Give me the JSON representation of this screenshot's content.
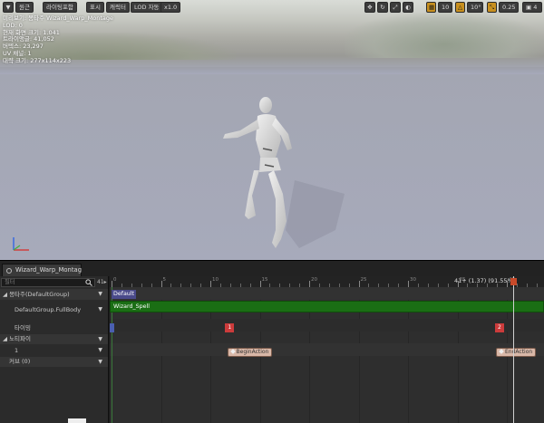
{
  "toolbar": {
    "menu_glyph": "▼",
    "perspective": "원근",
    "lighting": "라이팅포함",
    "show": "표시",
    "character": "캐릭터",
    "lod": "LOD 자동",
    "speed": "x1.0",
    "grid_snap": "10",
    "angle_snap": "10°",
    "scale_snap": "0.25",
    "camera_speed": "4"
  },
  "stats": [
    "미리보기: 몽타주 Wizard_Warp_Montage",
    "LOD: 0",
    "현재 화면 크기: 1.041",
    "트라이앵글: 41,052",
    "버텍스: 23,297",
    "UV 채널: 1",
    "대략 크기: 277x114x223"
  ],
  "tab": {
    "label": "Wizard_Warp_Montag"
  },
  "left_panel": {
    "filter_placeholder": "필터",
    "options_label": "41▸",
    "montage_row": "몽타주(DefaultGroup)",
    "slot_row": "DefaultGroup.FullBody",
    "timing_row": "타이밍",
    "notifies_row": "노티파이",
    "track_row": "1",
    "curves_row": "커브 (0)"
  },
  "timeline": {
    "frame_readout": "41+ (1.37) (91.55%)",
    "slot_name": "Default",
    "segment_label": "Wizard_Spell",
    "ruler_labels": [
      "0",
      "5",
      "10",
      "15",
      "20",
      "25",
      "30",
      "35",
      "40"
    ],
    "sections": [
      {
        "label": "",
        "frame": 0,
        "first": true
      },
      {
        "label": "1",
        "frame": 11.5
      },
      {
        "label": "2",
        "frame": 38.8
      }
    ],
    "notifies": [
      {
        "label": "BeginAction",
        "frame": 11.7
      },
      {
        "label": "EndAction",
        "frame": 38.9
      }
    ],
    "scrub_frame": 41
  },
  "colors": {
    "accent": "#c8901f",
    "segment": "#1a6e14",
    "section": "#cc3b3b"
  }
}
